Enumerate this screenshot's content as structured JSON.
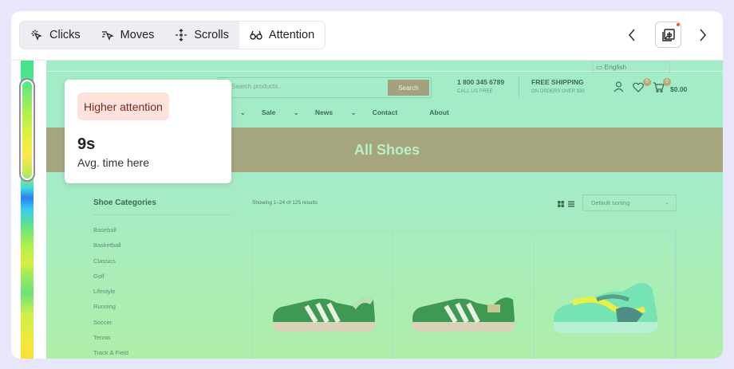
{
  "toolbar": {
    "modes": [
      {
        "label": "Clicks",
        "icon": "cursor-click-icon",
        "active": false
      },
      {
        "label": "Moves",
        "icon": "mouse-move-icon",
        "active": false
      },
      {
        "label": "Scrolls",
        "icon": "scroll-icon",
        "active": false
      },
      {
        "label": "Attention",
        "icon": "glasses-icon",
        "active": true
      }
    ],
    "prev_icon": "chevron-left-icon",
    "next_icon": "chevron-right-icon",
    "snapshot_icon": "add-snapshot-icon"
  },
  "tooltip": {
    "badge": "Higher attention",
    "value": "9s",
    "label": "Avg. time here"
  },
  "site": {
    "language": "English",
    "search_placeholder": "Search products...",
    "search_button": "Search",
    "phone": "1 800 345 6789",
    "phone_sub": "CALL US FREE",
    "shipping": "FREE SHIPPING",
    "shipping_sub": "ON ORDERS OVER $99",
    "wishlist_count": "0",
    "cart_count": "0",
    "cart_total": "$0.00",
    "menu": [
      "op",
      "Sale",
      "News",
      "Contact",
      "About"
    ],
    "banner_title": "All Shoes",
    "categories_title": "Shoe Categories",
    "categories": [
      "Baseball",
      "Basketball",
      "Classics",
      "Golf",
      "Lifestyle",
      "Running",
      "Soccer",
      "Tennis",
      "Track & Field"
    ],
    "results_text": "Showing 1–24 of 125 results",
    "sort_label": "Default sorting"
  },
  "colors": {
    "heat_overlay": "#a7eed3",
    "banner": "#a6a67e",
    "tooltip_badge_bg": "#fde3dc",
    "frame_bg": "#e7e6fb"
  }
}
